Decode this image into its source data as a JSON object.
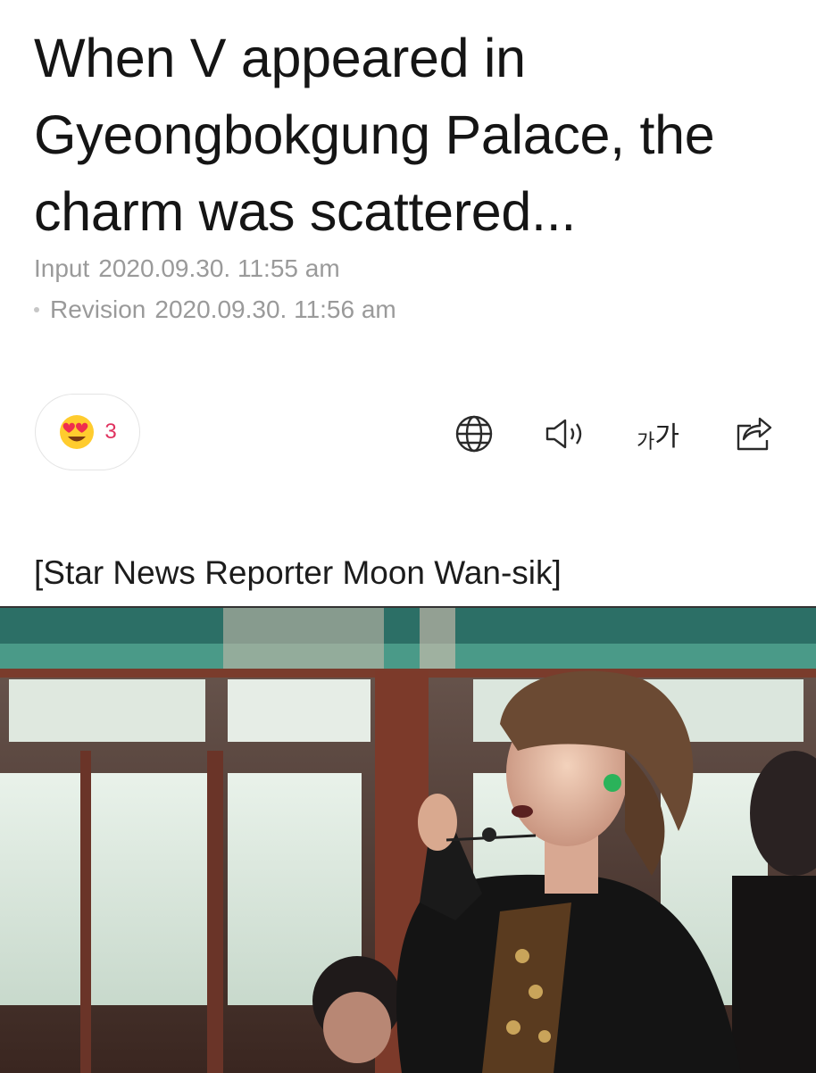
{
  "article": {
    "title_lines": [
      "When V appeared in",
      "Gyeongbokgung Palace, the",
      "charm was scattered..."
    ],
    "input_label": "Input",
    "input_time": "2020.09.30. 11:55 am",
    "revision_label": "Revision",
    "revision_time": "2020.09.30. 11:56 am",
    "byline": "[Star News Reporter Moon Wan-sik]"
  },
  "reaction": {
    "icon": "heart-eyes-emoji-icon",
    "count": "3",
    "count_color": "#e0325f"
  },
  "toolbar": {
    "icons": [
      "globe-icon",
      "speaker-icon",
      "font-size-icon",
      "share-icon"
    ],
    "font_size_small": "가",
    "font_size_large": "가"
  },
  "colors": {
    "meta_gray": "#9a9a9a",
    "reaction_red": "#e0325f"
  }
}
